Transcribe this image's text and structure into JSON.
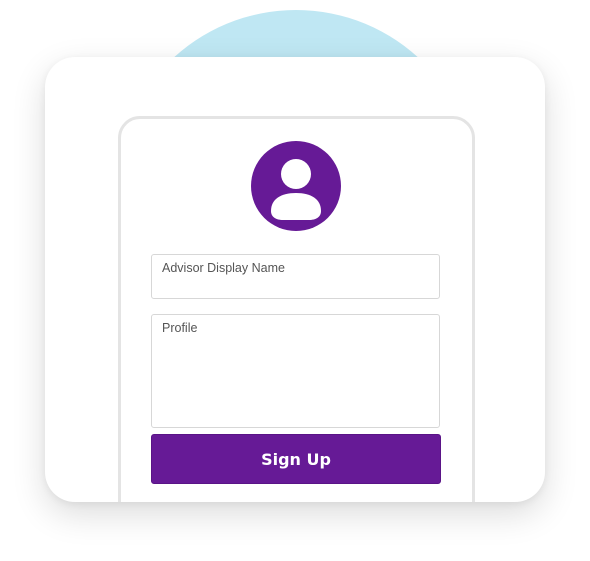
{
  "colors": {
    "brand_purple": "#661a96",
    "background_circle": "#bfe7f3",
    "card_background": "#ffffff",
    "border_gray": "#d7d7d7"
  },
  "avatar": {
    "icon": "user-icon"
  },
  "form": {
    "display_name": {
      "label": "Advisor Display Name",
      "value": ""
    },
    "profile": {
      "label": "Profile",
      "value": ""
    },
    "submit_label": "Sign Up"
  }
}
